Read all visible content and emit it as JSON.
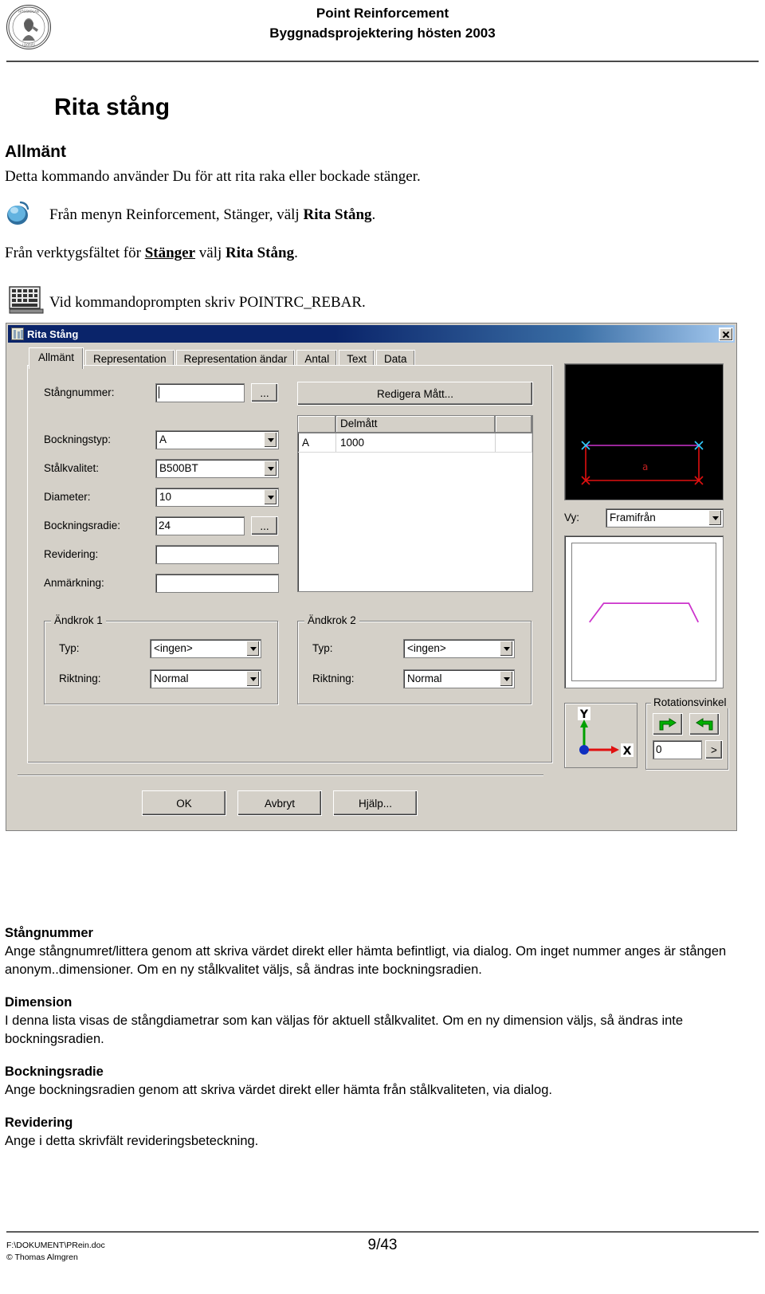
{
  "header": {
    "logo_alt": "university-seal",
    "line1": "Point Reinforcement",
    "line2": "Byggnadsprojektering hösten 2003"
  },
  "doc": {
    "title": "Rita stång",
    "section_allmant": "Allmänt",
    "intro": "Detta kommando använder Du för att rita raka eller bockade stänger.",
    "menu_line_pre": "Från menyn Reinforcement, Stänger, välj ",
    "menu_line_bold": "Rita Stång",
    "menu_line_post": ".",
    "toolbar_line_pre": "Från verktygsfältet för ",
    "toolbar_line_underline": "Stänger",
    "toolbar_line_mid": " välj ",
    "toolbar_line_bold": "Rita Stång",
    "toolbar_line_post": ".",
    "prompt_line": "Vid kommandoprompten skriv POINTRC_REBAR."
  },
  "dialog": {
    "title": "Rita Stång",
    "close_label": "×",
    "tabs": [
      {
        "label": "Allmänt",
        "active": true
      },
      {
        "label": "Representation",
        "active": false
      },
      {
        "label": "Representation ändar",
        "active": false
      },
      {
        "label": "Antal",
        "active": false
      },
      {
        "label": "Text",
        "active": false
      },
      {
        "label": "Data",
        "active": false
      }
    ],
    "fields": {
      "stangnummer_label": "Stångnummer:",
      "stangnummer_value": "",
      "stangnummer_browse": "...",
      "bockningstyp_label": "Bockningstyp:",
      "bockningstyp_value": "A",
      "stalkvalitet_label": "Stålkvalitet:",
      "stalkvalitet_value": "B500BT",
      "diameter_label": "Diameter:",
      "diameter_value": "10",
      "bockningsradie_label": "Bockningsradie:",
      "bockningsradie_value": "24",
      "bockningsradie_browse": "...",
      "revidering_label": "Revidering:",
      "revidering_value": "",
      "anmarkning_label": "Anmärkning:",
      "anmarkning_value": ""
    },
    "matt": {
      "edit_button": "Redigera Mått...",
      "columns": [
        "",
        "Delmått",
        ""
      ],
      "rows": [
        [
          "A",
          "1000",
          ""
        ]
      ]
    },
    "andkrok1": {
      "caption": "Ändkrok 1",
      "typ_label": "Typ:",
      "typ_value": "<ingen>",
      "riktning_label": "Riktning:",
      "riktning_value": "Normal"
    },
    "andkrok2": {
      "caption": "Ändkrok 2",
      "typ_label": "Typ:",
      "typ_value": "<ingen>",
      "riktning_label": "Riktning:",
      "riktning_value": "Normal"
    },
    "buttons": {
      "ok": "OK",
      "cancel": "Avbryt",
      "help": "Hjälp..."
    },
    "preview": {
      "vy_label": "Vy:",
      "vy_value": "Framifrån",
      "bar_label": "a",
      "axis_y": "Y",
      "axis_x": "X"
    },
    "rotation": {
      "caption": "Rotationsvinkel",
      "rotate_cw_icon": "rotate-clockwise-icon",
      "rotate_ccw_icon": "rotate-counterclockwise-icon",
      "value": "0",
      "more_label": ">"
    },
    "colors": {
      "face": "#d4d0c8",
      "titlebar": "#0a246a",
      "preview_bg": "#000000",
      "bar_red": "#e01010",
      "bar_magenta": "#cc33cc",
      "node_cyan": "#33ccff",
      "arrow_green": "#00a000"
    }
  },
  "notes": [
    {
      "head": "Stångnummer",
      "body": "Ange stångnumret/littera genom att skriva värdet direkt eller hämta befintligt, via dialog. Om inget nummer anges är stången anonym..dimensioner. Om en ny stålkvalitet väljs, så ändras inte bockningsradien."
    },
    {
      "head": "Dimension",
      "body": "I denna lista visas de stångdiametrar som kan väljas för aktuell stålkvalitet. Om en ny dimension väljs, så ändras inte bockningsradien."
    },
    {
      "head": "Bockningsradie",
      "body": "Ange bockningsradien genom att skriva värdet direkt eller hämta från stålkvaliteten, via dialog."
    },
    {
      "head": "Revidering",
      "body": "Ange i detta skrivfält revideringsbeteckning."
    }
  ],
  "footer": {
    "path": "F:\\DOKUMENT\\PRein.doc",
    "copyright": "© Thomas Almgren",
    "page": "9/43"
  }
}
